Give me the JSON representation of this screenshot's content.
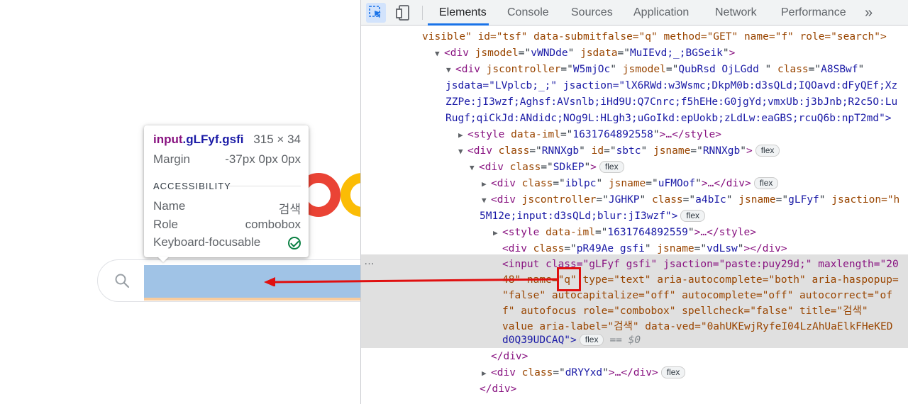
{
  "tooltip": {
    "tag": "input",
    "classes": ".gLFyf.gsfi",
    "size": "315 × 34",
    "margin_label": "Margin",
    "margin_value": "-37px 0px 0px",
    "section": "ACCESSIBILITY",
    "name_label": "Name",
    "name_value": "검색",
    "role_label": "Role",
    "role_value": "combobox",
    "focus_label": "Keyboard-focusable"
  },
  "devtools": {
    "tabs": [
      "Elements",
      "Console",
      "Sources",
      "Application",
      "Network",
      "Performance"
    ],
    "more": "»",
    "active_tab": "Elements"
  },
  "dom": {
    "l1": "visible\" id=\"tsf\" data-submitfalse=\"q\" method=\"GET\" name=\"f\" role=\"search\">",
    "l2": {
      "tag": "<div ",
      "attrs": [
        [
          "jsmodel",
          "vWNDde"
        ],
        [
          "jsdata",
          "MuIEvd;_;BGSeik"
        ]
      ],
      "end": ">"
    },
    "l3": {
      "tag": "<div ",
      "attrs": [
        [
          "jscontroller",
          "W5mjOc"
        ],
        [
          "jsmodel",
          "QubRsd OjLGdd "
        ],
        [
          "class",
          "A8SBwf"
        ]
      ]
    },
    "l4": "jsdata=\"LVplcb;_;\" jsaction=\"lX6RWd:w3Wsmc;DkpM0b:d3sQLd;IQOavd:dFyQEf;Xz",
    "l5": "ZZPe:jI3wzf;Aghsf:AVsnlb;iHd9U:Q7Cnrc;f5hEHe:G0jgYd;vmxUb:j3bJnb;R2c5O:Lu",
    "l6": "Rugf;qiCkJd:ANdidc;NOg9L:HLgh3;uGoIkd:epUokb;zLdLw:eaGBS;rcuQ6b:npT2md\">",
    "l7": {
      "open": "<style ",
      "attr": "data-iml",
      "val": "1631764892558",
      "close": ">…</style>"
    },
    "l8": {
      "attrs": [
        [
          "class",
          "RNNXgb"
        ],
        [
          "id",
          "sbtc"
        ],
        [
          "jsname",
          "RNNXgb"
        ]
      ],
      "badge": "flex"
    },
    "l9": {
      "attrs": [
        [
          "class",
          "SDkEP"
        ]
      ],
      "badge": "flex"
    },
    "l10": {
      "attrs": [
        [
          "class",
          "iblpc"
        ],
        [
          "jsname",
          "uFMOof"
        ]
      ],
      "close": ">…</div>",
      "badge": "flex"
    },
    "l11": {
      "attrs": [
        [
          "jscontroller",
          "JGHKP"
        ],
        [
          "class",
          "a4bIc"
        ],
        [
          "jsname",
          "gLFyf"
        ]
      ],
      "tail": "jsaction=\"h"
    },
    "l12": {
      "text": "5M12e;input:d3sQLd;blur:jI3wzf\">",
      "badge": "flex"
    },
    "l13": {
      "open": "<style ",
      "attr": "data-iml",
      "val": "1631764892559",
      "close": ">…</style>"
    },
    "l14": {
      "attrs": [
        [
          "class",
          "pR49Ae gsfi"
        ],
        [
          "jsname",
          "vdLsw"
        ]
      ],
      "close": "></div>"
    },
    "l15": "<input class=\"gLFyf gsfi\" jsaction=\"paste:puy29d;\" maxlength=\"20",
    "l16": "48\" name=\"q\" type=\"text\" aria-autocomplete=\"both\" aria-haspopup=",
    "l17": "\"false\" autocapitalize=\"off\" autocomplete=\"off\" autocorrect=\"of",
    "l18": "f\" autofocus role=\"combobox\" spellcheck=\"false\" title=\"검색\"",
    "l19": "value aria-label=\"검색\" data-ved=\"0ahUKEwjRyfeI04LzAhUaElkFHeKED",
    "l20": {
      "text": "d0Q39UDCAQ\">",
      "badge": "flex",
      "eq": "== $0"
    },
    "l21": "</div>",
    "l22": {
      "attrs": [
        [
          "class",
          "dRYYxd"
        ]
      ],
      "close": ">…</div>",
      "badge": "flex"
    },
    "l23": "</div>",
    "dots": "…"
  },
  "colors": {
    "highlight": "#a0c3e6",
    "annotation": "#e01010",
    "logo_red": "#ea4335",
    "logo_yellow": "#fbbc05"
  }
}
